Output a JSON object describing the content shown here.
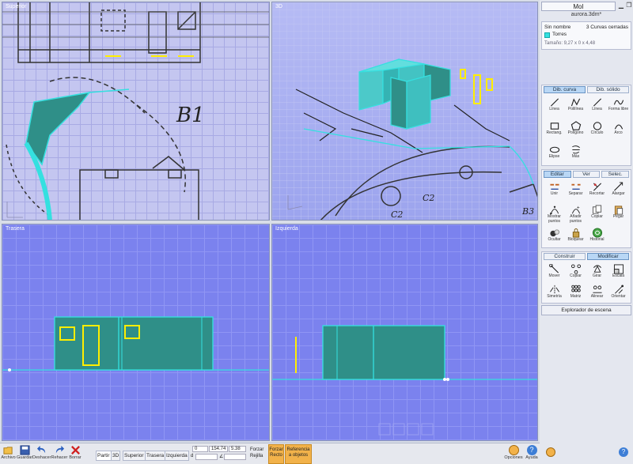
{
  "viewports": {
    "top": {
      "label": "Superior",
      "annotation": "B1"
    },
    "perspective": {
      "label": "3D",
      "annotations": [
        "C2",
        "C2",
        "B3"
      ]
    },
    "back": {
      "label": "Trasera"
    },
    "left": {
      "label": "Izquierda"
    }
  },
  "panel": {
    "window_title": "MoI",
    "file_name": "aurora.3dm*",
    "properties": {
      "name": "Sin nombre",
      "selection": "3 Curvas cerradas",
      "layer": "Torres",
      "size": "Tamaño: 9,27 x 0 x 4,48"
    },
    "draw_tabs": [
      "Dib. curva",
      "Dib. sólido"
    ],
    "draw_tools": [
      {
        "label": "Línea",
        "icon": "line-icon"
      },
      {
        "label": "Polilínea",
        "icon": "polyline-icon"
      },
      {
        "label": "Línea",
        "icon": "line-icon"
      },
      {
        "label": "Forma libre",
        "icon": "freeform-icon"
      },
      {
        "label": "Rectang.",
        "icon": "rectangle-icon"
      },
      {
        "label": "Polígono",
        "icon": "polygon-icon"
      },
      {
        "label": "Círculo",
        "icon": "circle-icon"
      },
      {
        "label": "Arco",
        "icon": "arc-icon"
      },
      {
        "label": "Elipse",
        "icon": "ellipse-icon"
      },
      {
        "label": "Más",
        "icon": "more-icon"
      }
    ],
    "edit_tabs": [
      "Editar",
      "Ver",
      "Selec."
    ],
    "edit_tools": [
      {
        "label": "Unir",
        "icon": "join-icon"
      },
      {
        "label": "Separar",
        "icon": "separate-icon"
      },
      {
        "label": "Recortar",
        "icon": "trim-icon"
      },
      {
        "label": "Alargar",
        "icon": "extend-icon"
      },
      {
        "label": "Mostrar puntos",
        "icon": "show-points-icon"
      },
      {
        "label": "Añadir puntos",
        "icon": "add-points-icon"
      },
      {
        "label": "Copiar",
        "icon": "copy-icon"
      },
      {
        "label": "Pegar",
        "icon": "paste-icon"
      },
      {
        "label": "Ocultar",
        "icon": "hide-icon"
      },
      {
        "label": "Bloquear",
        "icon": "lock-icon"
      },
      {
        "label": "Historial",
        "icon": "history-icon"
      }
    ],
    "transform_tabs": [
      "Construir",
      "Modificar"
    ],
    "transform_tools": [
      {
        "label": "Mover",
        "icon": "move-icon"
      },
      {
        "label": "Copiar",
        "icon": "copy-transform-icon"
      },
      {
        "label": "Girar",
        "icon": "rotate-icon"
      },
      {
        "label": "Escala",
        "icon": "scale-icon"
      },
      {
        "label": "Simetría",
        "icon": "mirror-icon"
      },
      {
        "label": "Matriz",
        "icon": "array-icon"
      },
      {
        "label": "Alinear",
        "icon": "align-icon"
      },
      {
        "label": "Orientar",
        "icon": "orient-icon"
      }
    ],
    "scene_browser": "Explorador de escena"
  },
  "bottombar": {
    "file_buttons": [
      {
        "label": "Archivo",
        "icon": "folder-icon"
      },
      {
        "label": "Guardar",
        "icon": "save-icon"
      },
      {
        "label": "Deshacer",
        "icon": "undo-icon"
      },
      {
        "label": "Rehacer",
        "icon": "redo-icon"
      },
      {
        "label": "Borrar",
        "icon": "delete-icon"
      }
    ],
    "views": [
      "Partir",
      "3D",
      "Superior",
      "Trasera",
      "Izquierda"
    ],
    "coords": {
      "x": "0",
      "y": "154.74",
      "z": "5.38",
      "distance_prefix": "d",
      "angle_prefix": "∠"
    },
    "snap": {
      "force": "Forzar",
      "grid": "Rejilla"
    },
    "orange_buttons": [
      "Forzar Recto",
      "Referencia a objetos"
    ],
    "help_buttons": [
      {
        "label": "Opciones",
        "icon": "options-icon"
      },
      {
        "label": "Ayuda",
        "icon": "help-icon"
      }
    ]
  },
  "colors": {
    "selection": "#35e0e0",
    "accent_yellow": "#ffee00",
    "viewport_blue": "#7b82ee"
  }
}
